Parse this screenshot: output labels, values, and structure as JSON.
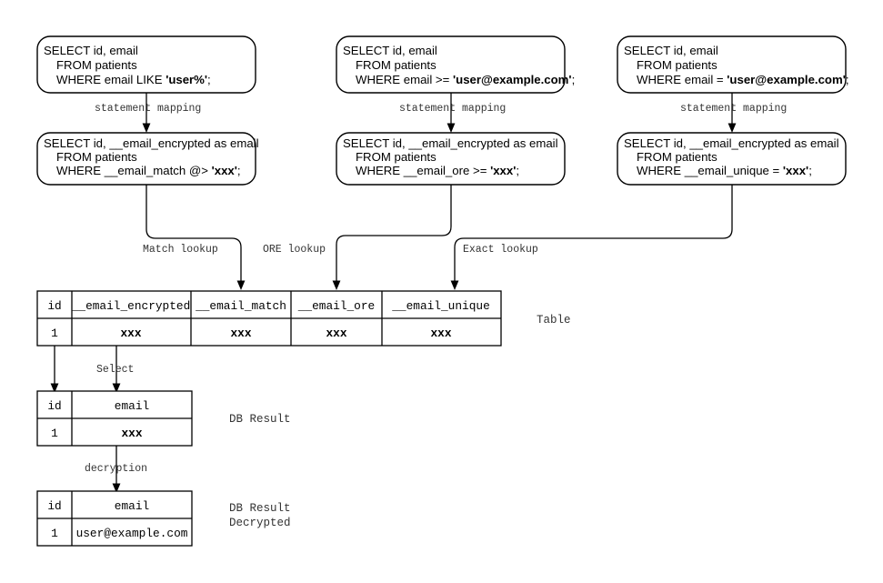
{
  "diagram": {
    "title": "Encrypted column query mapping flow",
    "colors": {
      "stroke": "#000000",
      "background": "#ffffff",
      "label_text": "#333333"
    },
    "columns": [
      {
        "key": "match",
        "plain_query": {
          "line1": "SELECT id, email",
          "line2": "FROM patients",
          "line3_prefix": "WHERE email LIKE ",
          "line3_literal": "'user%'",
          "line3_suffix": ";"
        },
        "mapping_label": "statement mapping",
        "mapped_query": {
          "line1": "SELECT id, __email_encrypted as email",
          "line2": "FROM patients",
          "line3_prefix": "WHERE __email_match @> ",
          "line3_literal": "'xxx'",
          "line3_suffix": ";"
        },
        "lookup_label": "Match lookup"
      },
      {
        "key": "ore",
        "plain_query": {
          "line1": "SELECT id, email",
          "line2": "FROM patients",
          "line3_prefix": "WHERE email >= ",
          "line3_literal": "'user@example.com'",
          "line3_suffix": ";"
        },
        "mapping_label": "statement mapping",
        "mapped_query": {
          "line1": "SELECT id, __email_encrypted as email",
          "line2": "FROM patients",
          "line3_prefix": "WHERE __email_ore >= ",
          "line3_literal": "'xxx'",
          "line3_suffix": ";"
        },
        "lookup_label": "ORE lookup"
      },
      {
        "key": "unique",
        "plain_query": {
          "line1": "SELECT id, email",
          "line2": "FROM patients",
          "line3_prefix": "WHERE email = ",
          "line3_literal": "'user@example.com'",
          "line3_suffix": ";"
        },
        "mapping_label": "statement mapping",
        "mapped_query": {
          "line1": "SELECT id, __email_encrypted as email",
          "line2": "FROM patients",
          "line3_prefix": "WHERE __email_unique = ",
          "line3_literal": "'xxx'",
          "line3_suffix": ";"
        },
        "lookup_label": "Exact lookup"
      }
    ],
    "tables": {
      "main": {
        "caption": "Table",
        "headers": [
          "id",
          "__email_encrypted",
          "__email_match",
          "__email_ore",
          "__email_unique"
        ],
        "rows": [
          [
            "1",
            "xxx",
            "xxx",
            "xxx",
            "xxx"
          ]
        ]
      },
      "db_result": {
        "caption": "DB Result",
        "headers": [
          "id",
          "email"
        ],
        "rows": [
          [
            "1",
            "xxx"
          ]
        ]
      },
      "db_result_decrypted": {
        "caption_line1": "DB Result",
        "caption_line2": "Decrypted",
        "headers": [
          "id",
          "email"
        ],
        "rows": [
          [
            "1",
            "user@example.com"
          ]
        ]
      }
    },
    "flow_labels": {
      "select": "Select",
      "decryption": "decryption"
    }
  }
}
